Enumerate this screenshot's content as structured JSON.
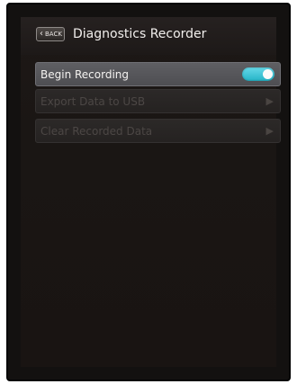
{
  "header": {
    "back_label": "BACK",
    "title": "Diagnostics Recorder"
  },
  "menu": [
    {
      "label": "Begin Recording",
      "control": "toggle",
      "toggle_on": true,
      "enabled": true
    },
    {
      "label": "Export Data to USB",
      "control": "chevron",
      "enabled": false
    },
    {
      "label": "Clear Recorded Data",
      "control": "chevron",
      "enabled": false
    }
  ],
  "icons": {
    "back": "chevron-left-icon",
    "row_arrow": "play-arrow-icon"
  },
  "colors": {
    "toggle_on": "#2fb9cc",
    "screen_background": "#1a1614",
    "active_row": "#58585c"
  }
}
